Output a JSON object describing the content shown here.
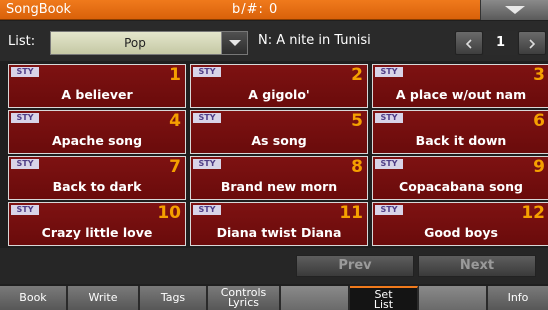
{
  "titlebar": {
    "app_name": "SongBook",
    "transpose": "b/#: 0",
    "menu_icon": "chevron-down-icon"
  },
  "list": {
    "label": "List:",
    "selected": "Pop",
    "entry_name": "N: A nite in Tunisi",
    "page": "1"
  },
  "entries": [
    {
      "tag": "STY",
      "number": "1",
      "name": "A believer"
    },
    {
      "tag": "STY",
      "number": "2",
      "name": "A gigolo'"
    },
    {
      "tag": "STY",
      "number": "3",
      "name": "A place w/out nam"
    },
    {
      "tag": "STY",
      "number": "4",
      "name": "Apache song"
    },
    {
      "tag": "STY",
      "number": "5",
      "name": "As song"
    },
    {
      "tag": "STY",
      "number": "6",
      "name": "Back it down"
    },
    {
      "tag": "STY",
      "number": "7",
      "name": "Back to dark"
    },
    {
      "tag": "STY",
      "number": "8",
      "name": "Brand new morn"
    },
    {
      "tag": "STY",
      "number": "9",
      "name": "Copacabana song"
    },
    {
      "tag": "STY",
      "number": "10",
      "name": "Crazy little love"
    },
    {
      "tag": "STY",
      "number": "11",
      "name": "Diana twist Diana"
    },
    {
      "tag": "STY",
      "number": "12",
      "name": "Good boys"
    }
  ],
  "nav": {
    "prev": "Prev",
    "next": "Next"
  },
  "tabs": {
    "book": "Book",
    "write": "Write",
    "tags": "Tags",
    "controls_line1": "Controls",
    "controls_line2": "Lyrics",
    "set_list_line1": "Set",
    "set_list_line2": "List",
    "info": "Info"
  },
  "colors": {
    "accent": "#f07a1c",
    "cell_bg": "#7e1212",
    "number": "#f5a000"
  }
}
